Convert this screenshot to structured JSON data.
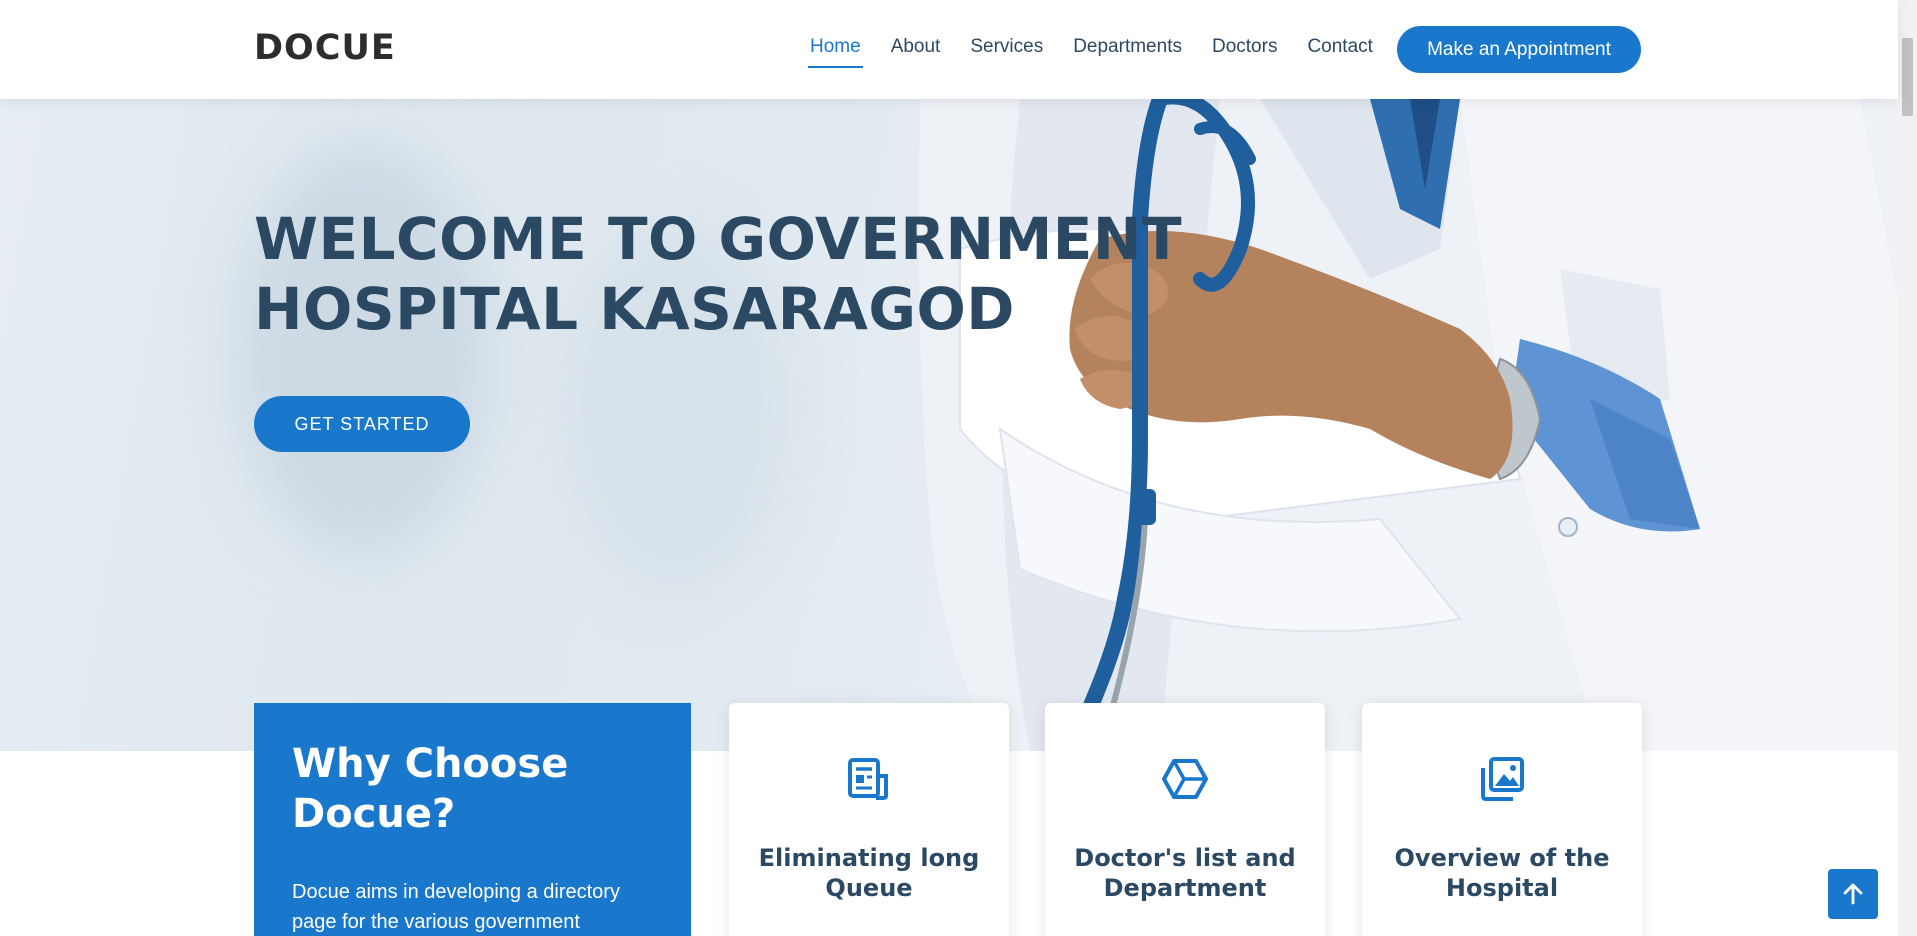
{
  "header": {
    "logo": "DOCUE",
    "nav": [
      {
        "label": "Home",
        "active": true
      },
      {
        "label": "About",
        "active": false
      },
      {
        "label": "Services",
        "active": false
      },
      {
        "label": "Departments",
        "active": false
      },
      {
        "label": "Doctors",
        "active": false
      },
      {
        "label": "Contact",
        "active": false
      }
    ],
    "appointment_button": "Make an Appointment"
  },
  "hero": {
    "title_line1": "WELCOME TO GOVERNMENT",
    "title_line2": "HOSPITAL KASARAGOD",
    "cta": "GET STARTED"
  },
  "why": {
    "title_line1": "Why Choose",
    "title_line2": "Docue?",
    "text_line1": "Docue aims in developing a directory",
    "text_line2": "page for the various government"
  },
  "cards": [
    {
      "icon": "receipt-icon",
      "title_line1": "Eliminating long",
      "title_line2": "Queue"
    },
    {
      "icon": "cube-icon",
      "title_line1": "Doctor's list and",
      "title_line2": "Department"
    },
    {
      "icon": "images-icon",
      "title_line1": "Overview of the",
      "title_line2": "Hospital"
    }
  ],
  "colors": {
    "accent": "#1977cc",
    "heading": "#2c4964"
  }
}
